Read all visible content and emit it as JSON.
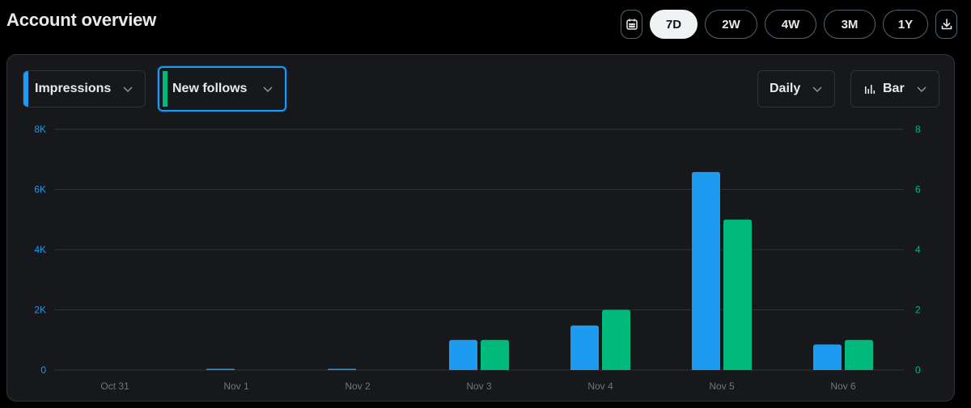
{
  "header": {
    "title": "Account overview",
    "calendar_icon": "calendar-icon",
    "download_icon": "download-icon",
    "ranges": [
      {
        "label": "7D",
        "active": true
      },
      {
        "label": "2W",
        "active": false
      },
      {
        "label": "4W",
        "active": false
      },
      {
        "label": "3M",
        "active": false
      },
      {
        "label": "1Y",
        "active": false
      }
    ]
  },
  "controls": {
    "metric1": {
      "label": "Impressions",
      "color": "#1d9bf0"
    },
    "metric2": {
      "label": "New follows",
      "color": "#00ba7c"
    },
    "interval": {
      "label": "Daily"
    },
    "chart_type": {
      "label": "Bar",
      "icon": "bar-chart-icon"
    }
  },
  "colors": {
    "left_axis": "#1d9bf0",
    "right_axis": "#00ba7c",
    "grid": "#2f3336",
    "x_label": "#71767b"
  },
  "chart_data": {
    "type": "bar",
    "categories": [
      "Oct 31",
      "Nov 1",
      "Nov 2",
      "Nov 3",
      "Nov 4",
      "Nov 5",
      "Nov 6"
    ],
    "series": [
      {
        "name": "Impressions",
        "axis": "left",
        "color": "#1d9bf0",
        "values": [
          0,
          20,
          20,
          1000,
          1480,
          6580,
          850
        ]
      },
      {
        "name": "New follows",
        "axis": "right",
        "color": "#00ba7c",
        "values": [
          0,
          0,
          0,
          1,
          2,
          5,
          1
        ]
      }
    ],
    "y_left": {
      "min": 0,
      "max": 8000,
      "ticks": [
        0,
        2000,
        4000,
        6000,
        8000
      ],
      "tick_labels": [
        "0",
        "2K",
        "4K",
        "6K",
        "8K"
      ]
    },
    "y_right": {
      "min": 0,
      "max": 8,
      "ticks": [
        0,
        2,
        4,
        6,
        8
      ],
      "tick_labels": [
        "0",
        "2",
        "4",
        "6",
        "8"
      ]
    },
    "grid": true,
    "legend": "none"
  }
}
